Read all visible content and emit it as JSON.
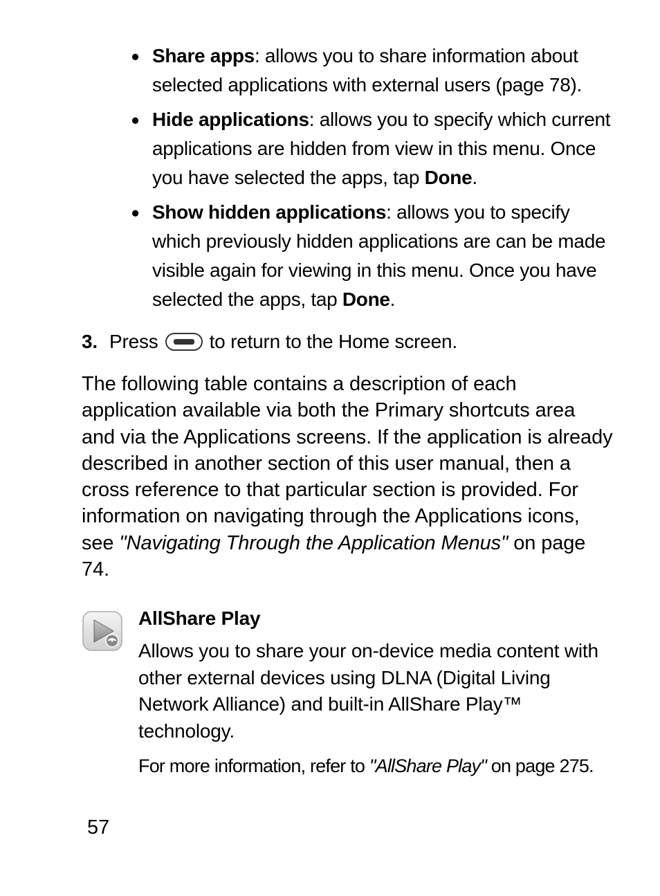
{
  "bullets": {
    "share_apps": {
      "label": "Share apps",
      "text": ": allows you to share information about selected applications with external users (page 78)."
    },
    "hide_apps": {
      "label": "Hide applications",
      "text_before": ": allows you to specify which current applications are hidden from view in this menu. Once you have selected the apps, tap ",
      "done": "Done",
      "text_after": "."
    },
    "show_hidden": {
      "label": "Show hidden applications",
      "text_before": ": allows you to specify which previously hidden applications are can be made visible again for viewing in this menu. Once you have selected the apps, tap ",
      "done": "Done",
      "text_after": "."
    }
  },
  "step3": {
    "num": "3.",
    "before": "Press",
    "after": "to return to the Home screen."
  },
  "paragraph": {
    "text_before": "The following table contains a description of each application available via both the Primary shortcuts area and via the Applications screens. If the application is already described in another section of this user manual, then a cross reference to that particular section is provided. For information on navigating through the Applications icons, see ",
    "italic": "\"Navigating Through the Application Menus\"",
    "text_after": " on page 74."
  },
  "app": {
    "title": "AllShare Play",
    "desc": "Allows you to share your on-device media content with other external devices using DLNA (Digital Living Network Alliance) and built-in AllShare Play™ technology.",
    "ref_before": "For more information, refer to ",
    "ref_italic": "\"AllShare Play\"",
    "ref_after": "  on page 275."
  },
  "page_number": "57"
}
